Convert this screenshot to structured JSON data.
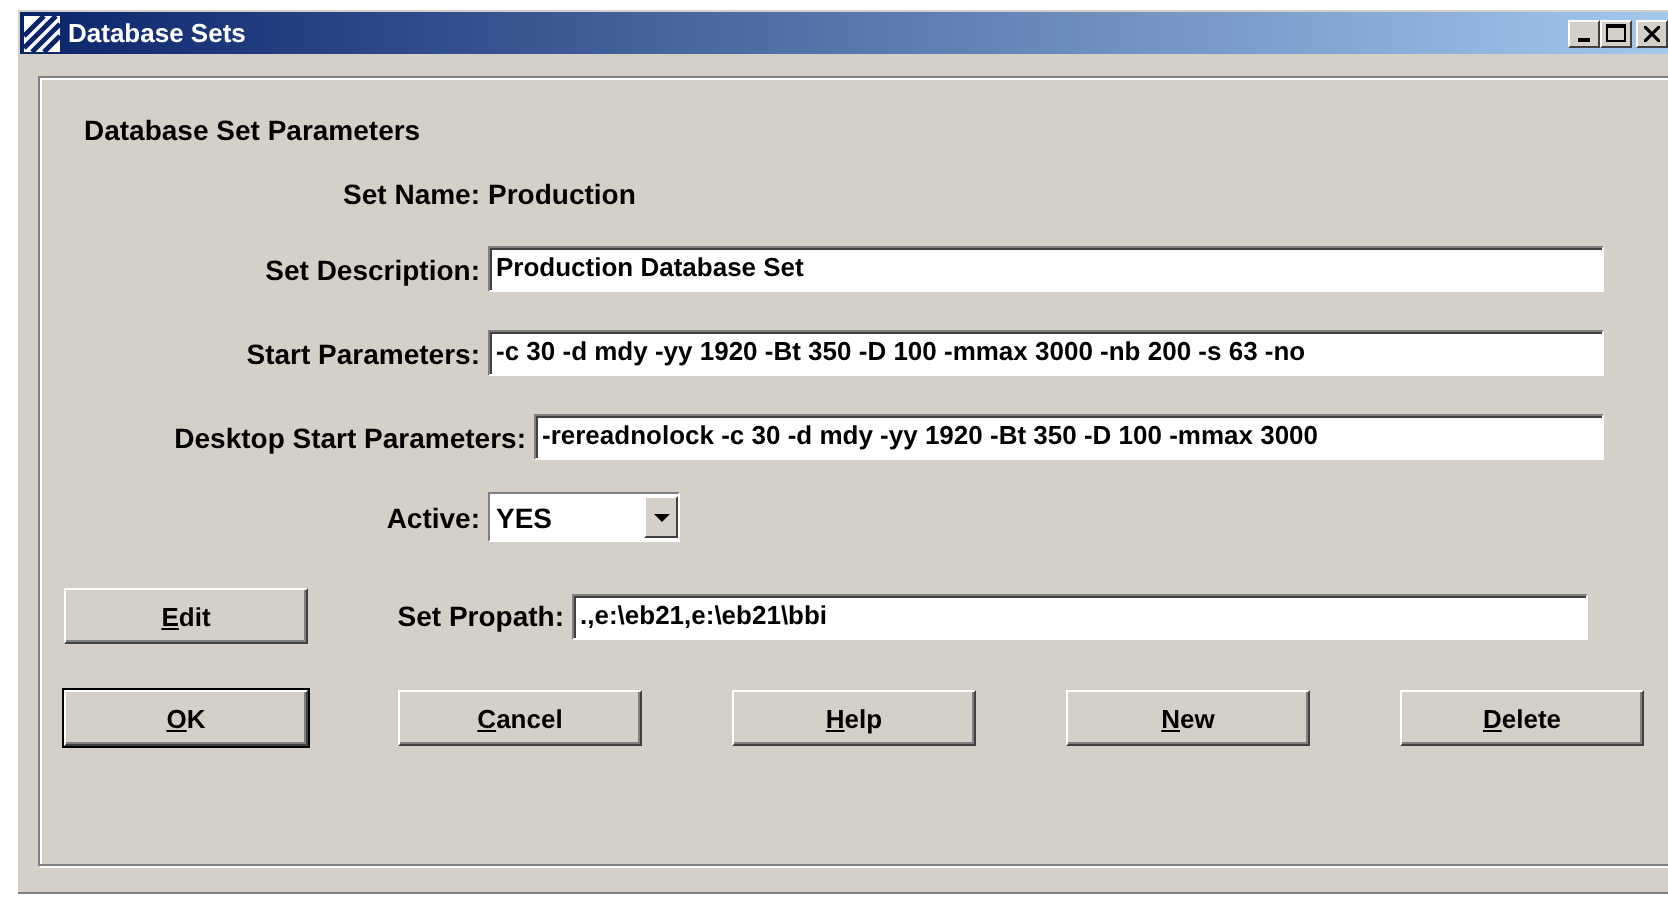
{
  "window": {
    "title": "Database Sets"
  },
  "group": {
    "title": "Database Set Parameters"
  },
  "set_name": {
    "label": "Set Name:",
    "value": "Production"
  },
  "fields": [
    {
      "label": "Set Description:",
      "value": "Production Database Set"
    },
    {
      "label": "Start Parameters:",
      "value": "-c 30 -d mdy -yy 1920 -Bt 350 -D 100 -mmax 3000 -nb 200 -s 63 -no"
    },
    {
      "label": "Desktop Start Parameters:",
      "value": "-rereadnolock -c 30 -d mdy -yy 1920 -Bt 350 -D 100 -mmax 3000"
    }
  ],
  "active": {
    "label": "Active:",
    "value": "YES"
  },
  "edit_button": {
    "label": "Edit",
    "mnemonic": true
  },
  "propath": {
    "label": "Set Propath:",
    "value": ".,e:\\eb21,e:\\eb21\\bbi"
  },
  "buttons": [
    {
      "label": "OK",
      "mnemonic": true,
      "default": true
    },
    {
      "label": "Cancel",
      "mnemonic": true,
      "default": false
    },
    {
      "label": "Help",
      "mnemonic": true,
      "default": false
    },
    {
      "label": "New",
      "mnemonic": true,
      "default": false
    },
    {
      "label": "Delete",
      "mnemonic": true,
      "default": false
    }
  ]
}
